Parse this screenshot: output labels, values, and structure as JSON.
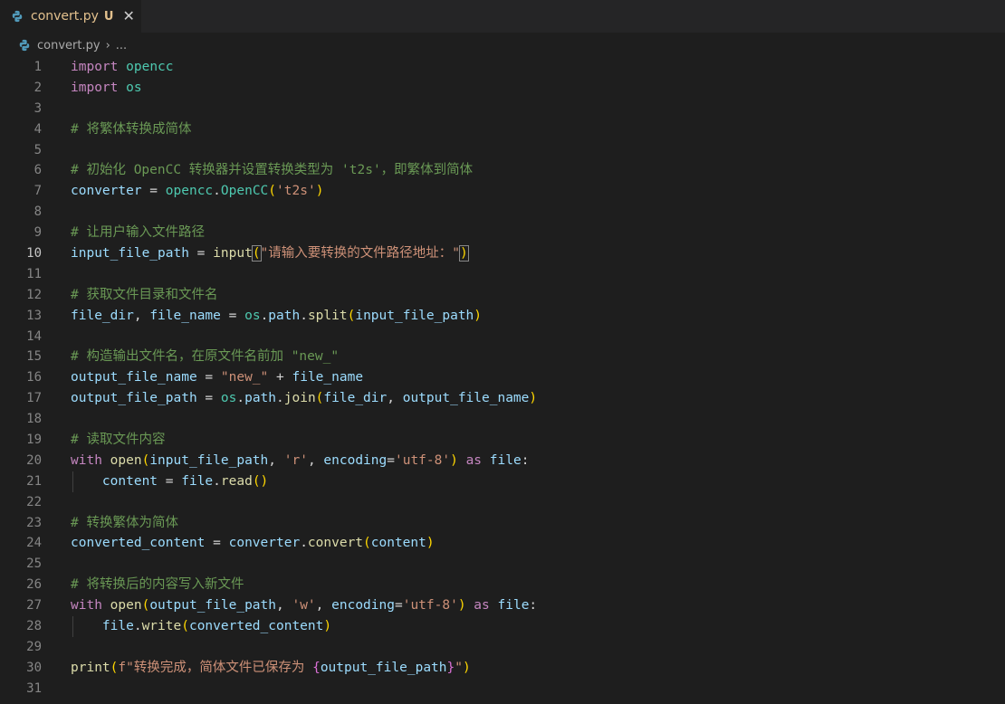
{
  "tab": {
    "filename": "convert.py",
    "status": "U",
    "close": "✕"
  },
  "breadcrumb": {
    "file": "convert.py",
    "separator": "›",
    "more": "..."
  },
  "editor": {
    "active_line": 10,
    "lines": [
      {
        "n": "1",
        "parts": [
          [
            "kw",
            "import"
          ],
          [
            "op",
            " "
          ],
          [
            "mod",
            "opencc"
          ]
        ]
      },
      {
        "n": "2",
        "parts": [
          [
            "kw",
            "import"
          ],
          [
            "op",
            " "
          ],
          [
            "mod",
            "os"
          ]
        ]
      },
      {
        "n": "3",
        "parts": []
      },
      {
        "n": "4",
        "parts": [
          [
            "com",
            "# 将繁体转换成简体"
          ]
        ]
      },
      {
        "n": "5",
        "parts": []
      },
      {
        "n": "6",
        "parts": [
          [
            "com",
            "# 初始化 OpenCC 转换器并设置转换类型为 't2s'，即繁体到简体"
          ]
        ]
      },
      {
        "n": "7",
        "parts": [
          [
            "var",
            "converter"
          ],
          [
            "op",
            " = "
          ],
          [
            "mod",
            "opencc"
          ],
          [
            "op",
            "."
          ],
          [
            "mod",
            "OpenCC"
          ],
          [
            "br1",
            "("
          ],
          [
            "str",
            "'t2s'"
          ],
          [
            "br1",
            ")"
          ]
        ]
      },
      {
        "n": "8",
        "parts": []
      },
      {
        "n": "9",
        "parts": [
          [
            "com",
            "# 让用户输入文件路径"
          ]
        ]
      },
      {
        "n": "10",
        "parts": [
          [
            "var",
            "input_file_path"
          ],
          [
            "op",
            " = "
          ],
          [
            "fn",
            "input"
          ],
          [
            "br1 brbox",
            "("
          ],
          [
            "str",
            "\"请输入要转换的文件路径地址：\""
          ],
          [
            "br1 brbox",
            ")"
          ]
        ]
      },
      {
        "n": "11",
        "parts": []
      },
      {
        "n": "12",
        "parts": [
          [
            "com",
            "# 获取文件目录和文件名"
          ]
        ]
      },
      {
        "n": "13",
        "parts": [
          [
            "var",
            "file_dir"
          ],
          [
            "op",
            ", "
          ],
          [
            "var",
            "file_name"
          ],
          [
            "op",
            " = "
          ],
          [
            "mod",
            "os"
          ],
          [
            "op",
            "."
          ],
          [
            "var",
            "path"
          ],
          [
            "op",
            "."
          ],
          [
            "fn",
            "split"
          ],
          [
            "br1",
            "("
          ],
          [
            "var",
            "input_file_path"
          ],
          [
            "br1",
            ")"
          ]
        ]
      },
      {
        "n": "14",
        "parts": []
      },
      {
        "n": "15",
        "parts": [
          [
            "com",
            "# 构造输出文件名，在原文件名前加 \"new_\""
          ]
        ]
      },
      {
        "n": "16",
        "parts": [
          [
            "var",
            "output_file_name"
          ],
          [
            "op",
            " = "
          ],
          [
            "str",
            "\"new_\""
          ],
          [
            "op",
            " + "
          ],
          [
            "var",
            "file_name"
          ]
        ]
      },
      {
        "n": "17",
        "parts": [
          [
            "var",
            "output_file_path"
          ],
          [
            "op",
            " = "
          ],
          [
            "mod",
            "os"
          ],
          [
            "op",
            "."
          ],
          [
            "var",
            "path"
          ],
          [
            "op",
            "."
          ],
          [
            "fn",
            "join"
          ],
          [
            "br1",
            "("
          ],
          [
            "var",
            "file_dir"
          ],
          [
            "op",
            ", "
          ],
          [
            "var",
            "output_file_name"
          ],
          [
            "br1",
            ")"
          ]
        ]
      },
      {
        "n": "18",
        "parts": []
      },
      {
        "n": "19",
        "parts": [
          [
            "com",
            "# 读取文件内容"
          ]
        ]
      },
      {
        "n": "20",
        "parts": [
          [
            "kw",
            "with"
          ],
          [
            "op",
            " "
          ],
          [
            "fn",
            "open"
          ],
          [
            "br1",
            "("
          ],
          [
            "var",
            "input_file_path"
          ],
          [
            "op",
            ", "
          ],
          [
            "str",
            "'r'"
          ],
          [
            "op",
            ", "
          ],
          [
            "var",
            "encoding"
          ],
          [
            "op",
            "="
          ],
          [
            "str",
            "'utf-8'"
          ],
          [
            "br1",
            ")"
          ],
          [
            "op",
            " "
          ],
          [
            "kw",
            "as"
          ],
          [
            "op",
            " "
          ],
          [
            "var",
            "file"
          ],
          [
            "op",
            ":"
          ]
        ]
      },
      {
        "n": "21",
        "indent": true,
        "parts": [
          [
            "op",
            "    "
          ],
          [
            "var",
            "content"
          ],
          [
            "op",
            " = "
          ],
          [
            "var",
            "file"
          ],
          [
            "op",
            "."
          ],
          [
            "fn",
            "read"
          ],
          [
            "br1",
            "()"
          ]
        ]
      },
      {
        "n": "22",
        "parts": []
      },
      {
        "n": "23",
        "parts": [
          [
            "com",
            "# 转换繁体为简体"
          ]
        ]
      },
      {
        "n": "24",
        "parts": [
          [
            "var",
            "converted_content"
          ],
          [
            "op",
            " = "
          ],
          [
            "var",
            "converter"
          ],
          [
            "op",
            "."
          ],
          [
            "fn",
            "convert"
          ],
          [
            "br1",
            "("
          ],
          [
            "var",
            "content"
          ],
          [
            "br1",
            ")"
          ]
        ]
      },
      {
        "n": "25",
        "parts": []
      },
      {
        "n": "26",
        "parts": [
          [
            "com",
            "# 将转换后的内容写入新文件"
          ]
        ]
      },
      {
        "n": "27",
        "parts": [
          [
            "kw",
            "with"
          ],
          [
            "op",
            " "
          ],
          [
            "fn",
            "open"
          ],
          [
            "br1",
            "("
          ],
          [
            "var",
            "output_file_path"
          ],
          [
            "op",
            ", "
          ],
          [
            "str",
            "'w'"
          ],
          [
            "op",
            ", "
          ],
          [
            "var",
            "encoding"
          ],
          [
            "op",
            "="
          ],
          [
            "str",
            "'utf-8'"
          ],
          [
            "br1",
            ")"
          ],
          [
            "op",
            " "
          ],
          [
            "kw",
            "as"
          ],
          [
            "op",
            " "
          ],
          [
            "var",
            "file"
          ],
          [
            "op",
            ":"
          ]
        ]
      },
      {
        "n": "28",
        "indent": true,
        "parts": [
          [
            "op",
            "    "
          ],
          [
            "var",
            "file"
          ],
          [
            "op",
            "."
          ],
          [
            "fn",
            "write"
          ],
          [
            "br1",
            "("
          ],
          [
            "var",
            "converted_content"
          ],
          [
            "br1",
            ")"
          ]
        ]
      },
      {
        "n": "29",
        "parts": []
      },
      {
        "n": "30",
        "parts": [
          [
            "fn",
            "print"
          ],
          [
            "br1",
            "("
          ],
          [
            "str",
            "f\"转换完成，简体文件已保存为 "
          ],
          [
            "br2",
            "{"
          ],
          [
            "var",
            "output_file_path"
          ],
          [
            "br2",
            "}"
          ],
          [
            "str",
            "\""
          ],
          [
            "br1",
            ")"
          ]
        ]
      },
      {
        "n": "31",
        "parts": []
      }
    ]
  }
}
